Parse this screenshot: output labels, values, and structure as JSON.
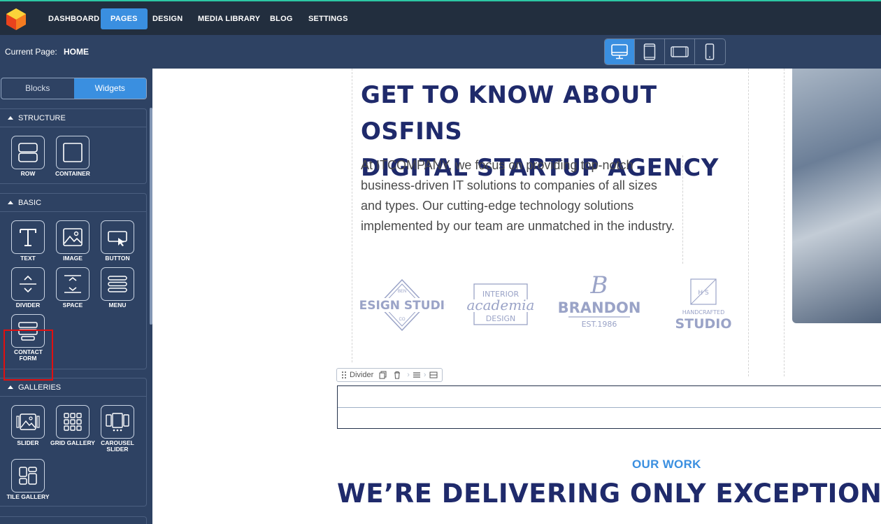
{
  "nav": {
    "items": [
      "DASHBOARD",
      "PAGES",
      "DESIGN",
      "MEDIA LIBRARY",
      "BLOG",
      "SETTINGS"
    ],
    "active": "PAGES"
  },
  "subbar": {
    "current_label": "Current Page:",
    "current_value": "HOME"
  },
  "devices": [
    "desktop-icon",
    "tablet-icon",
    "tablet-landscape-icon",
    "phone-icon"
  ],
  "sidebar": {
    "tabs": [
      "Blocks",
      "Widgets"
    ],
    "active_tab": "Widgets",
    "structure": {
      "title": "STRUCTURE",
      "items": [
        "ROW",
        "CONTAINER"
      ]
    },
    "basic": {
      "title": "BASIC",
      "items": [
        "TEXT",
        "IMAGE",
        "BUTTON",
        "DIVIDER",
        "SPACE",
        "MENU",
        "CONTACT FORM"
      ]
    },
    "galleries": {
      "title": "GALLERIES",
      "items": [
        "SLIDER",
        "GRID GALLERY",
        "CAROUSEL SLIDER",
        "TILE GALLERY"
      ]
    }
  },
  "canvas": {
    "heading_line1": "GET TO KNOW ABOUT OSFINS",
    "heading_line2": "DIGITAL STARTUP AGENCY",
    "paragraph": "At ITCOMPANY, we focus on providing top-notch business-driven IT solutions to companies of all sizes and types. Our cutting-edge technology solutions implemented by our team are unmatched in the industry.",
    "logos": [
      {
        "top": "BEN",
        "main": "DESIGN STUDIO",
        "bottom": "CO"
      },
      {
        "top": "INTERIOR",
        "main": "academia",
        "bottom": "DESIGN"
      },
      {
        "top": "B",
        "main": "BRANDON",
        "bottom": "EST.1986"
      },
      {
        "top": "H S",
        "main": "STUDIO",
        "bottom": "HANDCRAFTED"
      }
    ],
    "divider_toolbar_label": "Divider",
    "our_work": "OUR WORK",
    "big_heading": "WE’RE DELIVERING ONLY EXCEPTIONAL QUALI"
  },
  "colors": {
    "accent": "#3a8fe0",
    "navy": "#1f2a6b",
    "sidebar": "#2e4263",
    "topbar": "#222e3e"
  }
}
